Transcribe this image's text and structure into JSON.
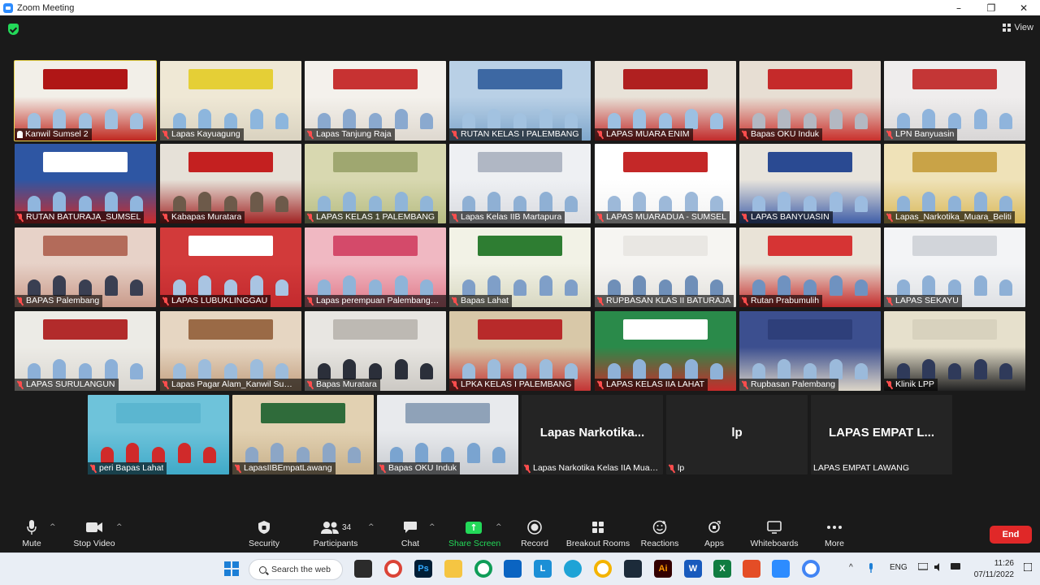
{
  "window": {
    "title": "Zoom Meeting",
    "min": "–",
    "max": "❐",
    "close": "✕"
  },
  "view_label": "View",
  "tiles": [
    {
      "name": "Kanwil Sumsel 2",
      "icon": "pin",
      "active": true,
      "bg": "#c0281f",
      "wall": "#f2efe8",
      "banner": "#b01616",
      "people": "#9fc0e0"
    },
    {
      "name": "Lapas Kayuagung",
      "icon": "mic-off",
      "bg": "#d9d2c0",
      "wall": "#efe8d5",
      "banner": "#e5cf36",
      "people": "#8db6dd"
    },
    {
      "name": "Lapas Tanjung Raja",
      "icon": "mic-off",
      "bg": "#ded8cf",
      "wall": "#f4f1ec",
      "banner": "#c73232",
      "people": "#8aa9cf"
    },
    {
      "name": "RUTAN KELAS I PALEMBANG",
      "icon": "mic-off",
      "bg": "#7fa7cc",
      "wall": "#b9d0e6",
      "banner": "#3d68a3",
      "people": "#a2c2e0"
    },
    {
      "name": "LAPAS MUARA ENIM",
      "icon": "mic-off",
      "bg": "#c22b2b",
      "wall": "#e8e2d8",
      "banner": "#b02020",
      "people": "#9cc0e2"
    },
    {
      "name": "Bapas OKU Induk",
      "icon": "mic-off",
      "bg": "#c9302c",
      "wall": "#e7ded3",
      "banner": "#c52a2a",
      "people": "#b3b8c2"
    },
    {
      "name": "LPN Banyuasin",
      "icon": "mic-off",
      "bg": "#d8d6d6",
      "wall": "#efeded",
      "banner": "#c43636",
      "people": "#8fb4dc"
    },
    {
      "name": "RUTAN BATURAJA_SUMSEL",
      "icon": "mic-off",
      "bg": "#cc2b2b",
      "wall": "#2e56a3",
      "banner": "#ffffff",
      "people": "#90b6de"
    },
    {
      "name": "Kabapas Muratara",
      "icon": "mic-off",
      "bg": "#a02323",
      "wall": "#e6e1d8",
      "banner": "#c42020",
      "people": "#6d5a4a"
    },
    {
      "name": "LAPAS KELAS 1 PALEMBANG",
      "icon": "mic-off",
      "bg": "#b6bc82",
      "wall": "#d8d8b0",
      "banner": "#9fa770",
      "people": "#90b5d8"
    },
    {
      "name": "Lapas Kelas IIB Martapura",
      "icon": "mic-off",
      "bg": "#d9dbe0",
      "wall": "#eef0f3",
      "banner": "#b0b7c4",
      "people": "#8fb0d4"
    },
    {
      "name": "LAPAS MUARADUA - SUMSEL",
      "icon": "mic-off",
      "bg": "#f2f2f2",
      "wall": "#ffffff",
      "banner": "#c42828",
      "people": "#9db9d9"
    },
    {
      "name": "LAPAS BANYUASIN",
      "icon": "mic-off",
      "bg": "#3f5ea8",
      "wall": "#e8e4dc",
      "banner": "#2a4a92",
      "people": "#9cbce0"
    },
    {
      "name": "Lapas_Narkotika_Muara_Beliti",
      "icon": "mic-off",
      "bg": "#d8b85a",
      "wall": "#efe2b8",
      "banner": "#c9a347",
      "people": "#8eb2d8"
    },
    {
      "name": "BAPAS Palembang",
      "icon": "mic-off",
      "bg": "#c99a8a",
      "wall": "#e7d2c8",
      "banner": "#b36b5a",
      "people": "#3a3f52"
    },
    {
      "name": "LAPAS LUBUKLINGGAU",
      "icon": "mic-off",
      "bg": "#c32a2e",
      "wall": "#d23a3a",
      "banner": "#ffffff",
      "people": "#a9c4e2"
    },
    {
      "name": "Lapas perempuan Palembang_Ra...",
      "icon": "mic-off",
      "bg": "#e07a8a",
      "wall": "#f0b8c2",
      "banner": "#d44a6a",
      "people": "#8fb4d8"
    },
    {
      "name": "Bapas Lahat",
      "icon": "mic-off",
      "bg": "#d8d8c2",
      "wall": "#f2f2e6",
      "banner": "#2e7d32",
      "people": "#7f9fc8"
    },
    {
      "name": "RUPBASAN KLAS II BATURAJA",
      "icon": "mic-off",
      "bg": "#e2e0dc",
      "wall": "#f6f5f2",
      "banner": "#e9e7e3",
      "people": "#6f8fb8"
    },
    {
      "name": "Rutan Prabumulih",
      "icon": "mic-off",
      "bg": "#c42d2d",
      "wall": "#e9e3d7",
      "banner": "#d63434",
      "people": "#6f92c0"
    },
    {
      "name": "LAPAS SEKAYU",
      "icon": "mic-off",
      "bg": "#dfe1e4",
      "wall": "#f3f4f6",
      "banner": "#d2d5da",
      "people": "#8eb0d6"
    },
    {
      "name": "LAPAS SURULANGUN",
      "icon": "mic-off",
      "bg": "#d9d6d0",
      "wall": "#ecebe6",
      "banner": "#b22b2b",
      "people": "#8cb0d8"
    },
    {
      "name": "Lapas Pagar Alam_Kanwil Sumsel",
      "icon": "mic-off",
      "bg": "#c2a080",
      "wall": "#e6d6c2",
      "banner": "#9a6a46",
      "people": "#9cbcdc"
    },
    {
      "name": "Bapas Muratara",
      "icon": "mic-off",
      "bg": "#ccc9c4",
      "wall": "#e8e6e2",
      "banner": "#bdb9b3",
      "people": "#2b2f3a"
    },
    {
      "name": "LPKA KELAS I PALEMBANG",
      "icon": "mic-off",
      "bg": "#c33434",
      "wall": "#d8c8a8",
      "banner": "#b82a2a",
      "people": "#9cbcdc"
    },
    {
      "name": "LAPAS KELAS IIA LAHAT",
      "icon": "mic-off",
      "bg": "#c72b2b",
      "wall": "#2a8a4a",
      "banner": "#ffffff",
      "people": "#8fb2d8"
    },
    {
      "name": "Rupbasan Palembang",
      "icon": "mic-off",
      "bg": "#dcd5c8",
      "wall": "#3c4f8f",
      "banner": "#2e3f7a",
      "people": "#9bbadb"
    },
    {
      "name": "Klinik LPP",
      "icon": "mic-off",
      "bg": "#222222",
      "wall": "#e6e0cc",
      "banner": "#d8d2be",
      "people": "#2f3a5a"
    },
    {
      "name": "peri Bapas Lahat",
      "icon": "mic-off",
      "bg": "#3fa9c8",
      "wall": "#6ec3da",
      "banner": "#5bb6d0",
      "people": "#d02a2a"
    },
    {
      "name": "LapasIIBEmpatLawang",
      "icon": "mic-off",
      "bg": "#c7b08a",
      "wall": "#e2d1b2",
      "banner": "#2f6b3a",
      "people": "#8ca6c6"
    },
    {
      "name": "Bapas OKU Induk",
      "icon": "mic-off",
      "bg": "#c8cbd0",
      "wall": "#e8eaed",
      "banner": "#8fa2b8",
      "people": "#7aa4d0"
    },
    {
      "name": "Lapas Narkotika Kelas IIA Muara...",
      "icon": "mic-off",
      "nameonly": true,
      "big": "Lapas  Narkotika..."
    },
    {
      "name": "lp",
      "icon": "mic-off",
      "nameonly": true,
      "big": "lp"
    },
    {
      "name": "LAPAS EMPAT LAWANG",
      "icon": "none",
      "nameonly": true,
      "big": "LAPAS  EMPAT  L..."
    }
  ],
  "toolbar": {
    "mute": "Mute",
    "stop_video": "Stop Video",
    "security": "Security",
    "participants": "Participants",
    "participants_count": "34",
    "chat": "Chat",
    "share_screen": "Share Screen",
    "record": "Record",
    "breakout_rooms": "Breakout Rooms",
    "reactions": "Reactions",
    "apps": "Apps",
    "whiteboards": "Whiteboards",
    "more": "More",
    "end": "End"
  },
  "taskbar": {
    "search_label": "Search the web",
    "language": "ENG",
    "time": "11:26",
    "date": "07/11/2022"
  },
  "colors": {
    "accent_green": "#23d959",
    "end_red": "#e02828",
    "active_border": "#e8d44d"
  }
}
